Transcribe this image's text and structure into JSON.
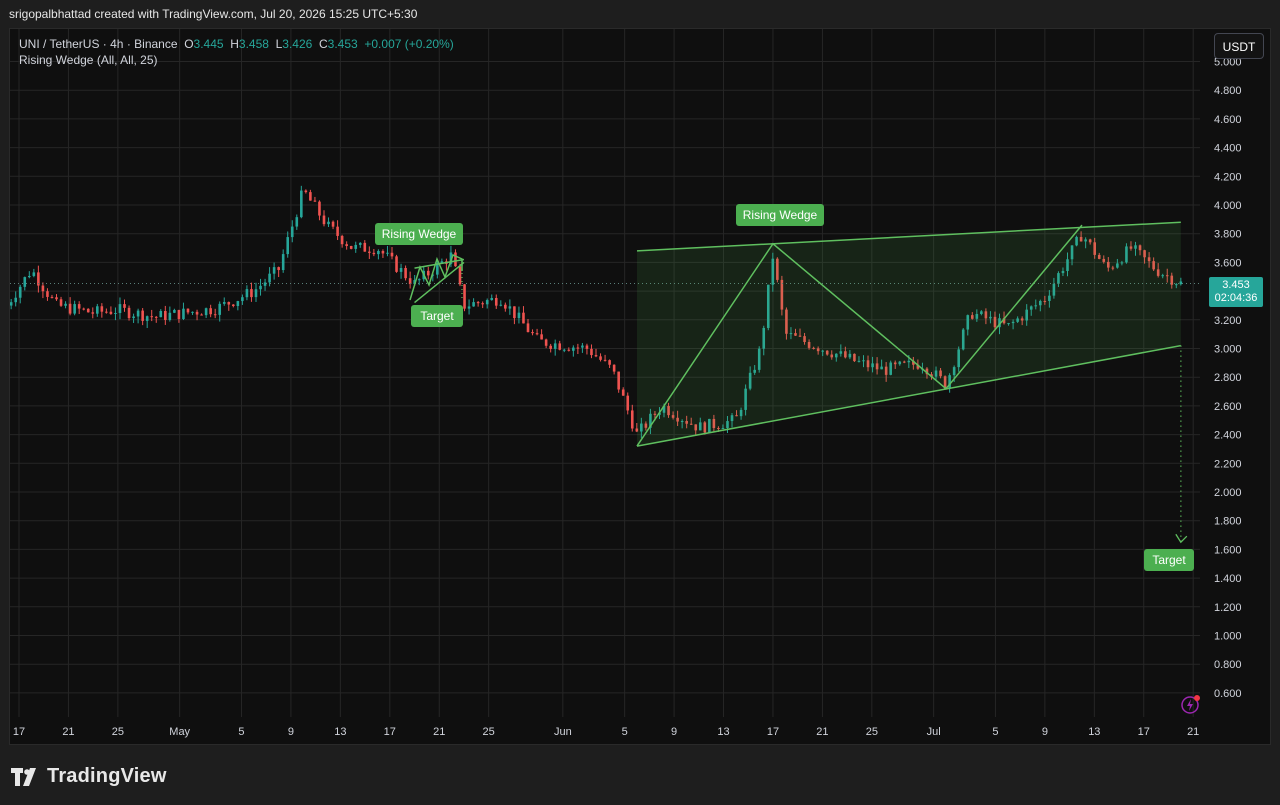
{
  "header": {
    "credit": "srigopalbhattad created with TradingView.com, Jul 20, 2026 15:25 UTC+5:30"
  },
  "legend": {
    "symbol": "UNI / TetherUS · 4h · Binance",
    "o_label": "O",
    "o_value": "3.445",
    "h_label": "H",
    "h_value": "3.458",
    "l_label": "L",
    "l_value": "3.426",
    "c_label": "C",
    "c_value": "3.453",
    "change": "+0.007 (+0.20%)",
    "indicator": "Rising Wedge (All, All, 25)"
  },
  "currency_button": "USDT",
  "price_tag": {
    "price": "3.453",
    "countdown": "02:04:36"
  },
  "badges": {
    "wedge_left": "Rising Wedge",
    "target_left": "Target",
    "wedge_right": "Rising Wedge",
    "target_right": "Target"
  },
  "brand": {
    "name": "TradingView"
  },
  "chart_data": {
    "type": "candlestick",
    "title": "UNI / TetherUS · 4h · Binance",
    "ylim": [
      0.5,
      5.0
    ],
    "y_ticks": [
      "5.000",
      "4.800",
      "4.600",
      "4.400",
      "4.200",
      "4.000",
      "3.800",
      "3.600",
      "3.400",
      "3.200",
      "3.000",
      "2.800",
      "2.600",
      "2.400",
      "2.200",
      "2.000",
      "1.800",
      "1.600",
      "1.400",
      "1.200",
      "1.000",
      "0.800",
      "0.600"
    ],
    "x_ticks": [
      "17",
      "21",
      "25",
      "May",
      "5",
      "9",
      "13",
      "17",
      "21",
      "25",
      "Jun",
      "5",
      "9",
      "13",
      "17",
      "21",
      "25",
      "Jul",
      "5",
      "9",
      "13",
      "17",
      "21"
    ],
    "grid": true,
    "colors": {
      "up": "#26a69a",
      "down": "#ef5350",
      "pattern": "#5fbf5f"
    },
    "last_price": 3.453,
    "price_path": [
      {
        "x": "Apr 16",
        "y": 3.3
      },
      {
        "x": "Apr 18",
        "y": 3.55
      },
      {
        "x": "Apr 20",
        "y": 3.3
      },
      {
        "x": "Apr 23",
        "y": 3.25
      },
      {
        "x": "Apr 25",
        "y": 3.27
      },
      {
        "x": "Apr 28",
        "y": 3.22
      },
      {
        "x": "May 3",
        "y": 3.28
      },
      {
        "x": "May 6",
        "y": 3.4
      },
      {
        "x": "May 8",
        "y": 3.55
      },
      {
        "x": "May 10",
        "y": 4.1
      },
      {
        "x": "May 12",
        "y": 3.85
      },
      {
        "x": "May 14",
        "y": 3.7
      },
      {
        "x": "May 16",
        "y": 3.7
      },
      {
        "x": "May 19",
        "y": 3.45
      },
      {
        "x": "May 22",
        "y": 3.65
      },
      {
        "x": "May 23",
        "y": 3.3
      },
      {
        "x": "May 26",
        "y": 3.35
      },
      {
        "x": "May 29",
        "y": 3.05
      },
      {
        "x": "Jun 2",
        "y": 3.0
      },
      {
        "x": "Jun 4",
        "y": 2.85
      },
      {
        "x": "Jun 6",
        "y": 2.4
      },
      {
        "x": "Jun 8",
        "y": 2.6
      },
      {
        "x": "Jun 11",
        "y": 2.45
      },
      {
        "x": "Jun 14",
        "y": 2.5
      },
      {
        "x": "Jun 16",
        "y": 3.0
      },
      {
        "x": "Jun 17",
        "y": 3.65
      },
      {
        "x": "Jun 18",
        "y": 3.1
      },
      {
        "x": "Jun 21",
        "y": 3.0
      },
      {
        "x": "Jun 24",
        "y": 2.9
      },
      {
        "x": "Jun 26",
        "y": 2.85
      },
      {
        "x": "Jun 29",
        "y": 2.9
      },
      {
        "x": "Jul 1",
        "y": 2.75
      },
      {
        "x": "Jul 3",
        "y": 3.25
      },
      {
        "x": "Jul 6",
        "y": 3.15
      },
      {
        "x": "Jul 9",
        "y": 3.35
      },
      {
        "x": "Jul 11",
        "y": 3.65
      },
      {
        "x": "Jul 12",
        "y": 3.8
      },
      {
        "x": "Jul 14",
        "y": 3.55
      },
      {
        "x": "Jul 16",
        "y": 3.7
      },
      {
        "x": "Jul 18",
        "y": 3.55
      },
      {
        "x": "Jul 20",
        "y": 3.453
      }
    ],
    "patterns": [
      {
        "name": "Rising Wedge",
        "upper": [
          {
            "x": "May 19",
            "y": 3.56
          },
          {
            "x": "May 23",
            "y": 3.62
          }
        ],
        "lower": [
          {
            "x": "May 19",
            "y": 3.32
          },
          {
            "x": "May 23",
            "y": 3.6
          }
        ]
      },
      {
        "name": "Rising Wedge",
        "upper": [
          {
            "x": "Jun 6",
            "y": 3.68
          },
          {
            "x": "Jul 20",
            "y": 3.88
          }
        ],
        "lower": [
          {
            "x": "Jun 6",
            "y": 2.32
          },
          {
            "x": "Jul 20",
            "y": 3.02
          }
        ],
        "target": 1.65
      }
    ]
  }
}
